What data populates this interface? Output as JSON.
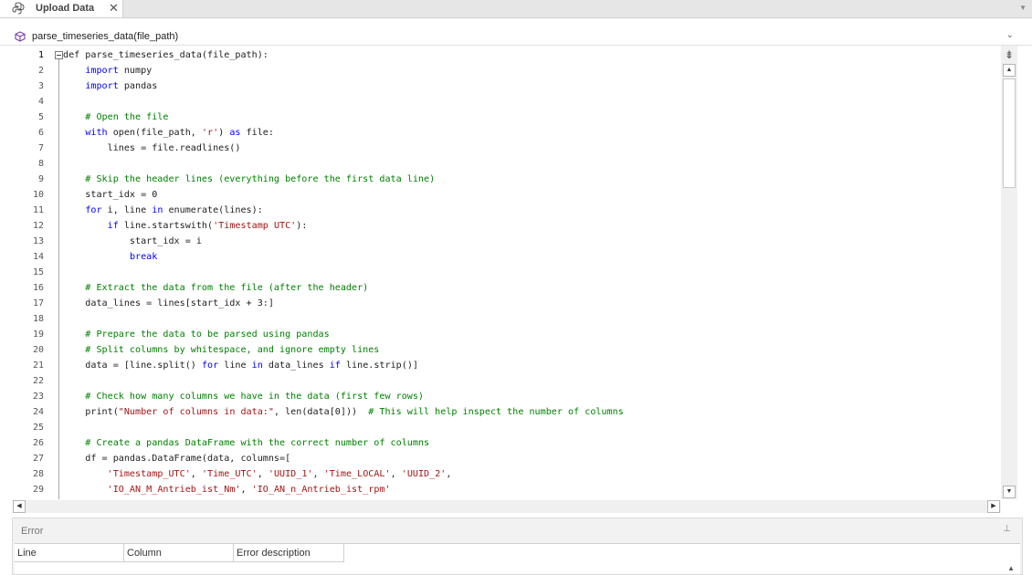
{
  "tab": {
    "title": "Upload Data",
    "close_glyph": "✕",
    "icon": "python-icon"
  },
  "function_bar": {
    "label": "parse_timeseries_data(file_path)",
    "icon": "function-cube-icon"
  },
  "editor": {
    "current_line": 1,
    "lines": [
      [
        {
          "t": "def parse_timeseries_data(file_path):",
          "c": "n"
        }
      ],
      [
        {
          "t": "    ",
          "c": "n"
        },
        {
          "t": "import",
          "c": "k"
        },
        {
          "t": " numpy",
          "c": "n"
        }
      ],
      [
        {
          "t": "    ",
          "c": "n"
        },
        {
          "t": "import",
          "c": "k"
        },
        {
          "t": " pandas",
          "c": "n"
        }
      ],
      [],
      [
        {
          "t": "    # Open the file",
          "c": "c"
        }
      ],
      [
        {
          "t": "    ",
          "c": "n"
        },
        {
          "t": "with",
          "c": "k"
        },
        {
          "t": " open(file_path, ",
          "c": "n"
        },
        {
          "t": "'r'",
          "c": "s"
        },
        {
          "t": ") ",
          "c": "n"
        },
        {
          "t": "as",
          "c": "k"
        },
        {
          "t": " file:",
          "c": "n"
        }
      ],
      [
        {
          "t": "        lines = file.readlines()",
          "c": "n"
        }
      ],
      [],
      [
        {
          "t": "    # Skip the header lines (everything before the first data line)",
          "c": "c"
        }
      ],
      [
        {
          "t": "    start_idx = 0",
          "c": "n"
        }
      ],
      [
        {
          "t": "    ",
          "c": "n"
        },
        {
          "t": "for",
          "c": "k"
        },
        {
          "t": " i, line ",
          "c": "n"
        },
        {
          "t": "in",
          "c": "k"
        },
        {
          "t": " enumerate(lines):",
          "c": "n"
        }
      ],
      [
        {
          "t": "        ",
          "c": "n"
        },
        {
          "t": "if",
          "c": "k"
        },
        {
          "t": " line.startswith(",
          "c": "n"
        },
        {
          "t": "'Timestamp UTC'",
          "c": "s"
        },
        {
          "t": "):",
          "c": "n"
        }
      ],
      [
        {
          "t": "            start_idx = i",
          "c": "n"
        }
      ],
      [
        {
          "t": "            ",
          "c": "n"
        },
        {
          "t": "break",
          "c": "k"
        }
      ],
      [],
      [
        {
          "t": "    # Extract the data from the file (after the header)",
          "c": "c"
        }
      ],
      [
        {
          "t": "    data_lines = lines[start_idx + 3:]",
          "c": "n"
        }
      ],
      [],
      [
        {
          "t": "    # Prepare the data to be parsed using pandas",
          "c": "c"
        }
      ],
      [
        {
          "t": "    # Split columns by whitespace, and ignore empty lines",
          "c": "c"
        }
      ],
      [
        {
          "t": "    data = [line.split() ",
          "c": "n"
        },
        {
          "t": "for",
          "c": "k"
        },
        {
          "t": " line ",
          "c": "n"
        },
        {
          "t": "in",
          "c": "k"
        },
        {
          "t": " data_lines ",
          "c": "n"
        },
        {
          "t": "if",
          "c": "k"
        },
        {
          "t": " line.strip()]",
          "c": "n"
        }
      ],
      [],
      [
        {
          "t": "    # Check how many columns we have in the data (first few rows)",
          "c": "c"
        }
      ],
      [
        {
          "t": "    print(",
          "c": "n"
        },
        {
          "t": "\"Number of columns in data:\"",
          "c": "s"
        },
        {
          "t": ", len(data[0]))  ",
          "c": "n"
        },
        {
          "t": "# This will help inspect the number of columns",
          "c": "c"
        }
      ],
      [],
      [
        {
          "t": "    # Create a pandas DataFrame with the correct number of columns",
          "c": "c"
        }
      ],
      [
        {
          "t": "    df = pandas.DataFrame(data, columns=[",
          "c": "n"
        }
      ],
      [
        {
          "t": "        ",
          "c": "n"
        },
        {
          "t": "'Timestamp_UTC'",
          "c": "s"
        },
        {
          "t": ", ",
          "c": "n"
        },
        {
          "t": "'Time_UTC'",
          "c": "s"
        },
        {
          "t": ", ",
          "c": "n"
        },
        {
          "t": "'UUID_1'",
          "c": "s"
        },
        {
          "t": ", ",
          "c": "n"
        },
        {
          "t": "'Time_LOCAL'",
          "c": "s"
        },
        {
          "t": ", ",
          "c": "n"
        },
        {
          "t": "'UUID_2'",
          "c": "s"
        },
        {
          "t": ",",
          "c": "n"
        }
      ],
      [
        {
          "t": "        ",
          "c": "n"
        },
        {
          "t": "'IO_AN_M_Antrieb_ist_Nm'",
          "c": "s"
        },
        {
          "t": ", ",
          "c": "n"
        },
        {
          "t": "'IO_AN_n_Antrieb_ist_rpm'",
          "c": "s"
        }
      ]
    ]
  },
  "error_panel": {
    "title": "Error",
    "columns": [
      "Line",
      "Column",
      "Error description"
    ]
  }
}
